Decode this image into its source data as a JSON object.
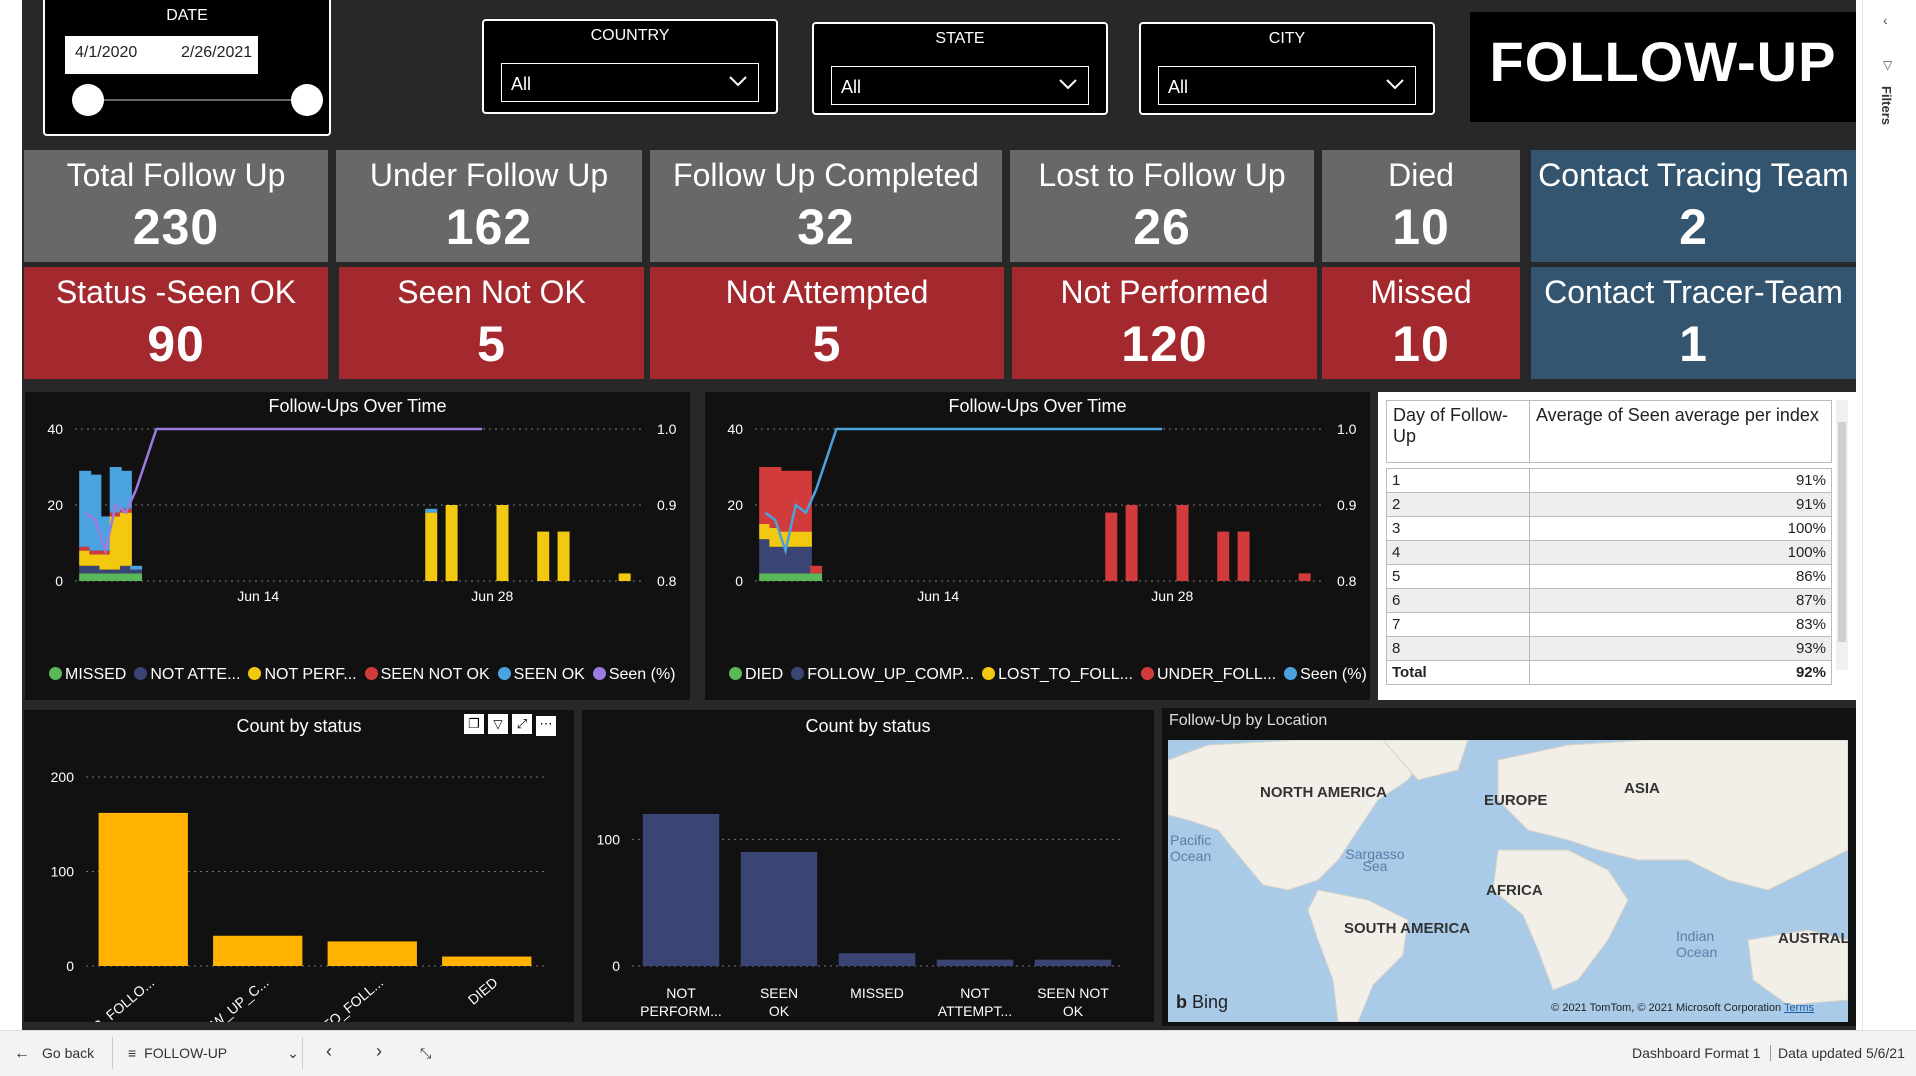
{
  "filters": {
    "date": {
      "title": "DATE",
      "start": "4/1/2020",
      "end": "2/26/2021"
    },
    "country": {
      "title": "COUNTRY",
      "value": "All"
    },
    "state": {
      "title": "STATE",
      "value": "All"
    },
    "city": {
      "title": "CITY",
      "value": "All"
    }
  },
  "page_title": "FOLLOW-UP",
  "cards_row1": [
    {
      "label": "Total Follow Up",
      "value": "230"
    },
    {
      "label": "Under Follow Up",
      "value": "162"
    },
    {
      "label": "Follow Up Completed",
      "value": "32"
    },
    {
      "label": "Lost to Follow Up",
      "value": "26"
    },
    {
      "label": "Died",
      "value": "10"
    },
    {
      "label": "Contact Tracing Team",
      "value": "2"
    }
  ],
  "cards_row2": [
    {
      "label": "Status -Seen OK",
      "value": "90"
    },
    {
      "label": "Seen Not OK",
      "value": "5"
    },
    {
      "label": "Not Attempted",
      "value": "5"
    },
    {
      "label": "Not Performed",
      "value": "120"
    },
    {
      "label": "Missed",
      "value": "10"
    },
    {
      "label": "Contact Tracer-Team",
      "value": "1"
    }
  ],
  "colors": {
    "gray_card": "#686868",
    "red_card": "#a3292e",
    "blue_card": "#34556f",
    "yellow": "#f2c811",
    "orange_bar": "#ffb300",
    "navy_bar": "#3b4574",
    "red_bar": "#d13b3b",
    "green": "#5ab858",
    "blue": "#4aa3df",
    "purple": "#9b7be0"
  },
  "chart_data": [
    {
      "type": "bar",
      "title": "Follow-Ups Over Time",
      "y_left_ticks": [
        "0",
        "20",
        "40"
      ],
      "y_right_ticks": [
        "0.8",
        "0.9",
        "1.0"
      ],
      "x_ticks": [
        "Jun 14",
        "Jun 28"
      ],
      "ylim": [
        0,
        40
      ],
      "y2lim": [
        0.8,
        1.0
      ],
      "legend": [
        {
          "name": "MISSED",
          "color": "#5ab858"
        },
        {
          "name": "NOT ATTE...",
          "color": "#3b4574"
        },
        {
          "name": "NOT PERF...",
          "color": "#f2c811"
        },
        {
          "name": "SEEN NOT OK",
          "color": "#d13b3b"
        },
        {
          "name": "SEEN OK",
          "color": "#4aa3df"
        },
        {
          "name": "Seen (%)",
          "color": "#9b7be0"
        }
      ],
      "stacked_series": [
        {
          "name": "MISSED",
          "color": "#5ab858",
          "values": [
            2,
            2,
            2,
            2,
            2,
            2,
            0,
            0,
            0,
            0,
            0,
            0,
            0,
            0,
            0
          ]
        },
        {
          "name": "NOT ATTE...",
          "color": "#3b4574",
          "values": [
            2,
            2,
            1,
            1,
            2,
            1,
            0,
            0,
            0,
            0,
            0,
            0,
            0,
            0,
            0
          ]
        },
        {
          "name": "NOT PERF...",
          "color": "#f2c811",
          "values": [
            4,
            3,
            4,
            14,
            14,
            0,
            18,
            20,
            20,
            13,
            13,
            2,
            0,
            0,
            0
          ]
        },
        {
          "name": "SEEN NOT OK",
          "color": "#d13b3b",
          "values": [
            1,
            1,
            1,
            1,
            1,
            0,
            0,
            0,
            0,
            0,
            0,
            0,
            0,
            0,
            0
          ]
        },
        {
          "name": "SEEN OK",
          "color": "#4aa3df",
          "values": [
            20,
            20,
            9,
            12,
            10,
            1,
            1,
            0,
            0,
            0,
            0,
            0,
            0,
            0,
            0
          ]
        }
      ],
      "x_positions": [
        1,
        2,
        3,
        4,
        5,
        6,
        35,
        37,
        42,
        46,
        48,
        54,
        0,
        0,
        0
      ],
      "line_series": {
        "name": "Seen (%)",
        "color": "#9b7be0",
        "x": [
          1,
          2,
          3,
          4,
          5,
          6,
          8,
          40
        ],
        "values": [
          0.89,
          0.88,
          0.84,
          0.9,
          0.89,
          0.92,
          1.0,
          1.0
        ]
      }
    },
    {
      "type": "bar",
      "title": "Follow-Ups Over Time",
      "y_left_ticks": [
        "0",
        "20",
        "40"
      ],
      "y_right_ticks": [
        "0.8",
        "0.9",
        "1.0"
      ],
      "x_ticks": [
        "Jun 14",
        "Jun 28"
      ],
      "ylim": [
        0,
        40
      ],
      "y2lim": [
        0.8,
        1.0
      ],
      "legend": [
        {
          "name": "DIED",
          "color": "#5ab858"
        },
        {
          "name": "FOLLOW_UP_COMP...",
          "color": "#3b4574"
        },
        {
          "name": "LOST_TO_FOLL...",
          "color": "#f2c811"
        },
        {
          "name": "UNDER_FOLL...",
          "color": "#d13b3b"
        },
        {
          "name": "Seen (%)",
          "color": "#4aa3df"
        }
      ],
      "stacked_series": [
        {
          "name": "DIED",
          "color": "#5ab858",
          "values": [
            2,
            2,
            2,
            2,
            2,
            2,
            0,
            0,
            0,
            0,
            0,
            0,
            0
          ]
        },
        {
          "name": "FOLLOW_UP_COMP...",
          "color": "#3b4574",
          "values": [
            9,
            7,
            7,
            7,
            7,
            0,
            0,
            0,
            0,
            0,
            0,
            0,
            0
          ]
        },
        {
          "name": "LOST_TO_FOLL...",
          "color": "#f2c811",
          "values": [
            4,
            5,
            4,
            4,
            4,
            0,
            0,
            0,
            0,
            0,
            0,
            0,
            0
          ]
        },
        {
          "name": "UNDER_FOLL...",
          "color": "#d13b3b",
          "values": [
            15,
            16,
            16,
            16,
            16,
            2,
            18,
            20,
            20,
            13,
            13,
            2,
            0
          ]
        }
      ],
      "x_positions": [
        1,
        2,
        3,
        4,
        5,
        6,
        35,
        37,
        42,
        46,
        48,
        54,
        0
      ],
      "line_series": {
        "name": "Seen (%)",
        "color": "#4aa3df",
        "x": [
          1,
          2,
          3,
          4,
          5,
          6,
          8,
          40
        ],
        "values": [
          0.89,
          0.88,
          0.84,
          0.9,
          0.89,
          0.92,
          1.0,
          1.0
        ]
      }
    },
    {
      "type": "bar",
      "title": "Count by status",
      "categories": [
        "UNDER_FOLLO...",
        "FOLLOW_UP_C...",
        "LOST_TO_FOLL...",
        "DIED"
      ],
      "values": [
        162,
        32,
        26,
        10
      ],
      "y_ticks": [
        "0",
        "100",
        "200"
      ],
      "ylim": [
        0,
        200
      ],
      "color": "#ffb300"
    },
    {
      "type": "bar",
      "title": "Count by status",
      "categories": [
        "NOT PERFORM...",
        "SEEN OK",
        "MISSED",
        "NOT ATTEMPT...",
        "SEEN NOT OK"
      ],
      "values": [
        120,
        90,
        10,
        5,
        5
      ],
      "y_ticks": [
        "0",
        "100"
      ],
      "ylim": [
        0,
        150
      ],
      "color": "#3b4574"
    },
    {
      "type": "table",
      "columns": [
        "Day of Follow-Up",
        "Average of Seen average per index"
      ],
      "rows": [
        [
          "1",
          "91%"
        ],
        [
          "2",
          "91%"
        ],
        [
          "3",
          "100%"
        ],
        [
          "4",
          "100%"
        ],
        [
          "5",
          "86%"
        ],
        [
          "6",
          "87%"
        ],
        [
          "7",
          "83%"
        ],
        [
          "8",
          "93%"
        ]
      ],
      "total": [
        "Total",
        "92%"
      ]
    }
  ],
  "map": {
    "title": "Follow-Up by Location",
    "labels": [
      "NORTH AMERICA",
      "EUROPE",
      "ASIA",
      "AFRICA",
      "SOUTH AMERICA",
      "AUSTRALIA",
      "Pacific Ocean",
      "Sargasso Sea",
      "Indian Ocean"
    ],
    "bing": "Bing",
    "copyright": "© 2021 TomTom, © 2021 Microsoft Corporation",
    "terms": "Terms"
  },
  "bottombar": {
    "back": "Go back",
    "page": "FOLLOW-UP",
    "report": "Dashboard Format 1",
    "updated": "Data updated 5/6/21"
  },
  "right_pane": {
    "filters": "Filters"
  }
}
